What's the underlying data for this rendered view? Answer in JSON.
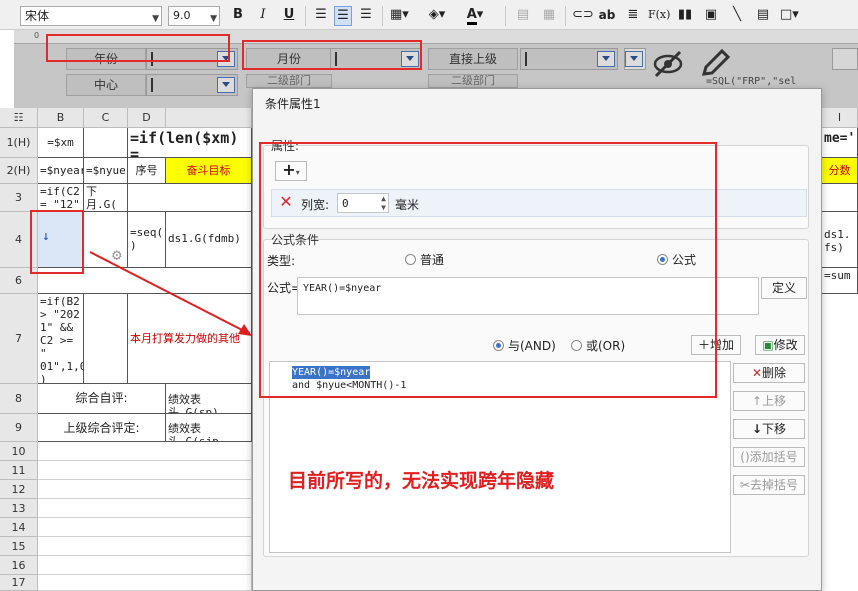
{
  "toolbar": {
    "font_name": "宋体",
    "font_size": "9.0",
    "bold": "B",
    "italic": "I",
    "underline": "U",
    "abc_label": "ab",
    "fx_label": "F(x)"
  },
  "params": {
    "year_label": "年份",
    "month_label": "月份",
    "dept_label": "直接上级",
    "center_label": "中心",
    "dept2_label": "二级部门",
    "dept3_label": "二级部门",
    "sql_text": "=SQL(\"FRP\",\"sel"
  },
  "grid": {
    "columns": [
      "B",
      "C",
      "D",
      "",
      "I"
    ],
    "rows": [
      "1(H)",
      "2(H)",
      "3",
      "4",
      "6",
      "7",
      "8",
      "9",
      "10",
      "11",
      "12",
      "13",
      "14",
      "15",
      "16",
      "17"
    ],
    "cells": {
      "b1": "=$xm",
      "d1": "=if(len($xm) =",
      "d1b": "\"  \"+\"-\"",
      "i1": "me='",
      "b2": "=$nyear",
      "c2": "=$nyue",
      "d2": "序号",
      "e2": "奋斗目标",
      "i2": "分数",
      "b3": "=if(C2\n= \"12\"",
      "c3": "下月.G(\nxyue)",
      "d4": "=seq(\n)",
      "e4": "ds1.G(fdmb)",
      "i4": "ds1.\nfs)",
      "i6": "=sum",
      "b7": "=if(B2\n> \"202\n1\" &&\nC2 >= \"\n01\",1,0\n)",
      "d7": "本月打算发力做的其他",
      "b8": "综合自评:",
      "d8": "绩效表头.G(sp)",
      "b9": "上级综合评定:",
      "d9": "绩效表头.G(sjp"
    }
  },
  "dialog": {
    "title": "条件属性1",
    "attr_section": "属性:",
    "add_symbol": "+",
    "col_width_label": "列宽:",
    "col_width_value": "0",
    "unit_label": "毫米",
    "formula_section": "公式条件",
    "type_label": "类型:",
    "type_normal": "普通",
    "type_formula": "公式",
    "formula_label": "公式=",
    "formula_value": "YEAR()=$nyear",
    "define_button": "定义",
    "and_label": "与(AND)",
    "or_label": "或(OR)",
    "add_button": "增加",
    "modify_button": "修改",
    "delete_button": "删除",
    "up_button": "上移",
    "down_button": "下移",
    "add_paren_button": "添加括号",
    "remove_paren_button": "去掉括号",
    "condition_line1": "YEAR()=$nyear",
    "condition_line2": "and $nyue<MONTH()-1"
  },
  "annotation": "目前所写的，无法实现跨年隐藏",
  "colors": {
    "accent": "#e22a2a",
    "highlight": "#ffff00"
  }
}
